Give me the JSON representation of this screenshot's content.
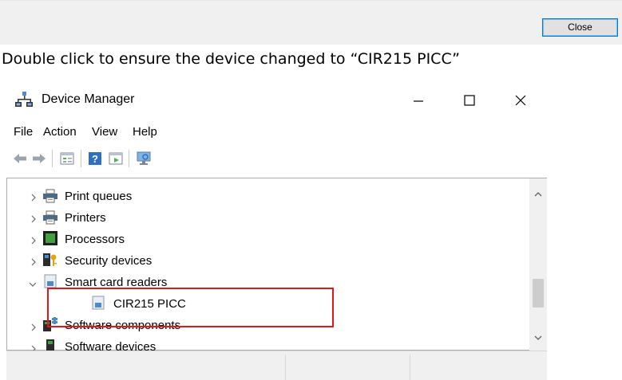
{
  "dialog": {
    "close_label": "Close"
  },
  "caption": "Double click to ensure the device changed to “CIR215 PICC”",
  "window": {
    "title": "Device Manager",
    "controls": {
      "minimize_icon": "minimize-icon",
      "maximize_icon": "maximize-icon",
      "close_icon": "close-icon"
    },
    "menu": [
      "File",
      "Action",
      "View",
      "Help"
    ],
    "toolbar": [
      "back-arrow-icon",
      "forward-arrow-icon",
      "properties-icon",
      "help-icon",
      "update-driver-icon",
      "scan-hardware-icon"
    ]
  },
  "tree": [
    {
      "label": "Print queues",
      "icon": "printer-queue-icon",
      "state": "collapsed"
    },
    {
      "label": "Printers",
      "icon": "printer-icon",
      "state": "collapsed"
    },
    {
      "label": "Processors",
      "icon": "processor-icon",
      "state": "collapsed"
    },
    {
      "label": "Security devices",
      "icon": "security-key-icon",
      "state": "collapsed"
    },
    {
      "label": "Smart card readers",
      "icon": "smart-card-reader-icon",
      "state": "expanded"
    },
    {
      "label": "CIR215 PICC",
      "icon": "card-reader-device-icon",
      "state": "child"
    },
    {
      "label": "Software components",
      "icon": "software-component-icon",
      "state": "collapsed"
    },
    {
      "label": "Software devices",
      "icon": "software-device-icon",
      "state": "collapsed"
    }
  ],
  "colors": {
    "highlight": "#e8141c",
    "accent": "#0078d7"
  }
}
